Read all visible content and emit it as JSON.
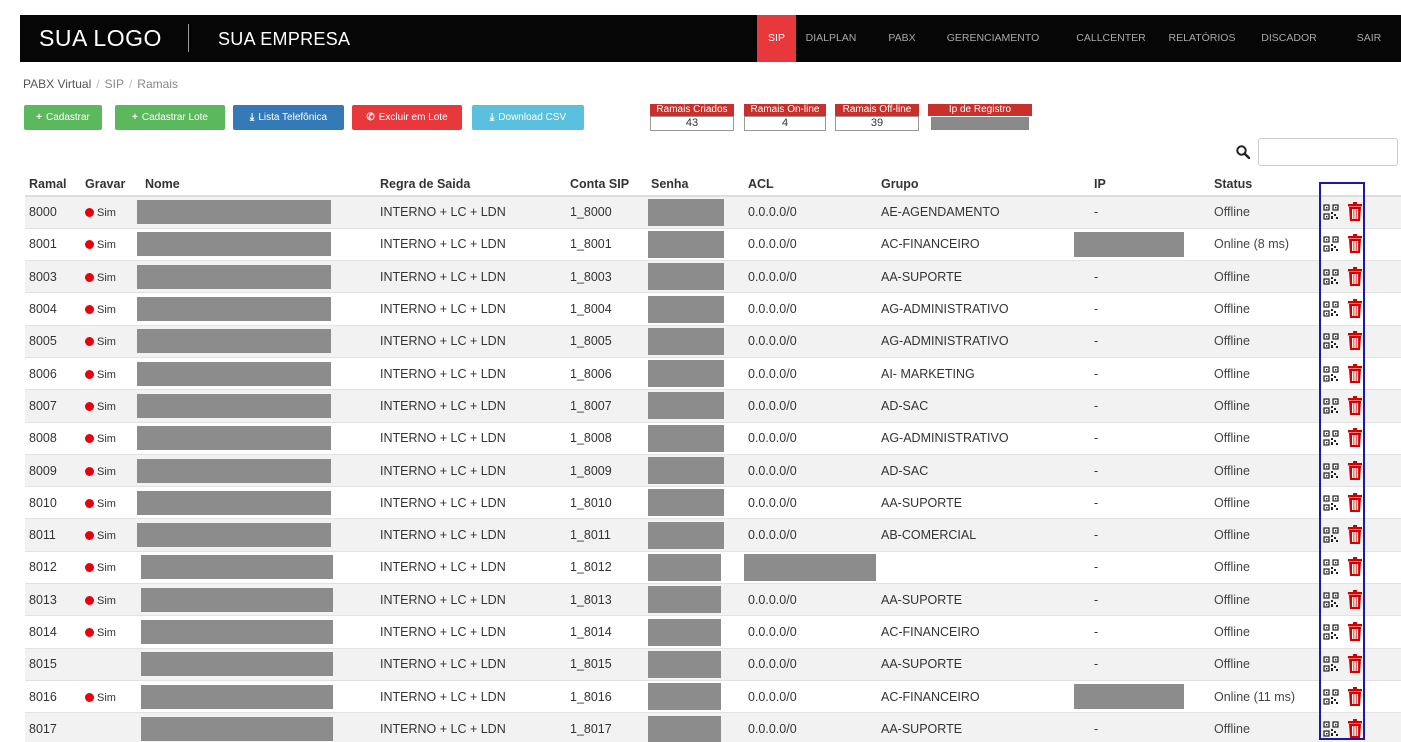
{
  "topbar": {
    "logo": "SUA LOGO",
    "company": "SUA EMPRESA",
    "nav": [
      {
        "label": "SIP",
        "active": true
      },
      {
        "label": "DIALPLAN"
      },
      {
        "label": "PABX"
      },
      {
        "label": "GERENCIAMENTO"
      },
      {
        "label": "CALLCENTER"
      },
      {
        "label": "RELATÓRIOS"
      },
      {
        "label": "DISCADOR"
      },
      {
        "label": "SAIR"
      }
    ]
  },
  "breadcrumb": [
    "PABX Virtual",
    "SIP",
    "Ramais"
  ],
  "actions": {
    "cadastrar": "Cadastrar",
    "cadastrar_lote": "Cadastrar Lote",
    "lista_telefonica": "Lista Telefônica",
    "excluir_lote": "Excluir em Lote",
    "download_csv": "Download CSV"
  },
  "counters": {
    "criados": {
      "label": "Ramais Criados",
      "value": "43"
    },
    "online": {
      "label": "Ramais On-line",
      "value": "4"
    },
    "offline": {
      "label": "Ramais Off-line",
      "value": "39"
    },
    "ip_registro": {
      "label": "Ip de Registro"
    }
  },
  "search": {
    "placeholder": ""
  },
  "table": {
    "headers": [
      "Ramal",
      "Gravar",
      "Nome",
      "Regra de Saida",
      "Conta SIP",
      "Senha",
      "ACL",
      "Grupo",
      "IP",
      "Status"
    ],
    "rows": [
      {
        "ramal": "8000",
        "gravar": "Sim",
        "regra": "INTERNO + LC + LDN",
        "conta": "1_8000",
        "acl": "0.0.0.0/0",
        "grupo": "AE-AGENDAMENTO",
        "ip": "-",
        "status": "Offline"
      },
      {
        "ramal": "8001",
        "gravar": "Sim",
        "regra": "INTERNO + LC + LDN",
        "conta": "1_8001",
        "acl": "0.0.0.0/0",
        "grupo": "AC-FINANCEIRO",
        "ip": "",
        "status": "Online (8 ms)"
      },
      {
        "ramal": "8003",
        "gravar": "Sim",
        "regra": "INTERNO + LC + LDN",
        "conta": "1_8003",
        "acl": "0.0.0.0/0",
        "grupo": "AA-SUPORTE",
        "ip": "-",
        "status": "Offline"
      },
      {
        "ramal": "8004",
        "gravar": "Sim",
        "regra": "INTERNO + LC + LDN",
        "conta": "1_8004",
        "acl": "0.0.0.0/0",
        "grupo": "AG-ADMINISTRATIVO",
        "ip": "-",
        "status": "Offline"
      },
      {
        "ramal": "8005",
        "gravar": "Sim",
        "regra": "INTERNO + LC + LDN",
        "conta": "1_8005",
        "acl": "0.0.0.0/0",
        "grupo": "AG-ADMINISTRATIVO",
        "ip": "-",
        "status": "Offline"
      },
      {
        "ramal": "8006",
        "gravar": "Sim",
        "regra": "INTERNO + LC + LDN",
        "conta": "1_8006",
        "acl": "0.0.0.0/0",
        "grupo": "AI- MARKETING",
        "ip": "-",
        "status": "Offline"
      },
      {
        "ramal": "8007",
        "gravar": "Sim",
        "regra": "INTERNO + LC + LDN",
        "conta": "1_8007",
        "acl": "0.0.0.0/0",
        "grupo": "AD-SAC",
        "ip": "-",
        "status": "Offline"
      },
      {
        "ramal": "8008",
        "gravar": "Sim",
        "regra": "INTERNO + LC + LDN",
        "conta": "1_8008",
        "acl": "0.0.0.0/0",
        "grupo": "AG-ADMINISTRATIVO",
        "ip": "-",
        "status": "Offline"
      },
      {
        "ramal": "8009",
        "gravar": "Sim",
        "regra": "INTERNO + LC + LDN",
        "conta": "1_8009",
        "acl": "0.0.0.0/0",
        "grupo": "AD-SAC",
        "ip": "-",
        "status": "Offline"
      },
      {
        "ramal": "8010",
        "gravar": "Sim",
        "regra": "INTERNO + LC + LDN",
        "conta": "1_8010",
        "acl": "0.0.0.0/0",
        "grupo": "AA-SUPORTE",
        "ip": "-",
        "status": "Offline"
      },
      {
        "ramal": "8011",
        "gravar": "Sim",
        "regra": "INTERNO + LC + LDN",
        "conta": "1_8011",
        "acl": "0.0.0.0/0",
        "grupo": "AB-COMERCIAL",
        "ip": "-",
        "status": "Offline"
      },
      {
        "ramal": "8012",
        "gravar": "Sim",
        "regra": "INTERNO + LC + LDN",
        "conta": "1_8012",
        "acl": "",
        "grupo": "",
        "ip": "-",
        "status": "Offline"
      },
      {
        "ramal": "8013",
        "gravar": "Sim",
        "regra": "INTERNO + LC + LDN",
        "conta": "1_8013",
        "acl": "0.0.0.0/0",
        "grupo": "AA-SUPORTE",
        "ip": "-",
        "status": "Offline"
      },
      {
        "ramal": "8014",
        "gravar": "Sim",
        "regra": "INTERNO + LC + LDN",
        "conta": "1_8014",
        "acl": "0.0.0.0/0",
        "grupo": "AC-FINANCEIRO",
        "ip": "-",
        "status": "Offline"
      },
      {
        "ramal": "8015",
        "gravar": "",
        "regra": "INTERNO + LC + LDN",
        "conta": "1_8015",
        "acl": "0.0.0.0/0",
        "grupo": "AA-SUPORTE",
        "ip": "-",
        "status": "Offline"
      },
      {
        "ramal": "8016",
        "gravar": "Sim",
        "regra": "INTERNO + LC + LDN",
        "conta": "1_8016",
        "acl": "0.0.0.0/0",
        "grupo": "AC-FINANCEIRO",
        "ip": "",
        "status": "Online (11 ms)"
      },
      {
        "ramal": "8017",
        "gravar": "",
        "regra": "INTERNO + LC + LDN",
        "conta": "1_8017",
        "acl": "0.0.0.0/0",
        "grupo": "AA-SUPORTE",
        "ip": "-",
        "status": "Offline"
      }
    ]
  },
  "colors": {
    "topbar_bg": "#060606",
    "accent_red": "#e8383c",
    "counter_red": "#c9302c",
    "btn_green": "#5cb85c",
    "btn_blue": "#337ab7",
    "btn_cyan": "#5bc0de",
    "highlight_border": "#1a1aa8"
  },
  "icons": {
    "row_action_1": "qr-code-icon",
    "row_action_2": "trash-icon",
    "search": "magnifier-icon",
    "record": "record-dot-icon"
  }
}
